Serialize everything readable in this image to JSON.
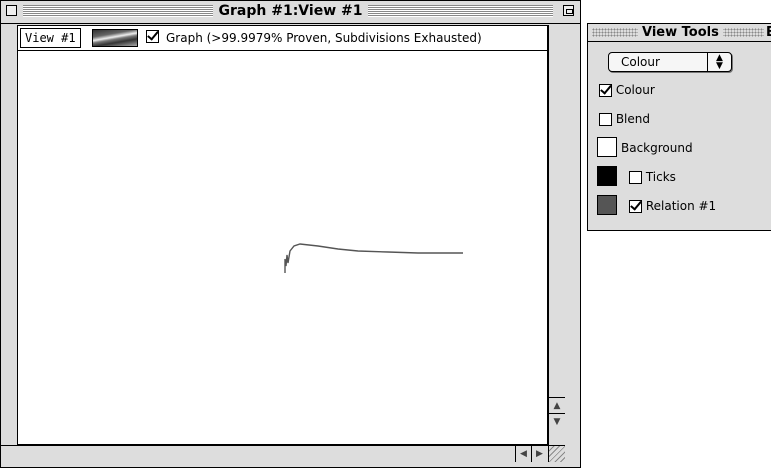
{
  "graph_window": {
    "title": "Graph #1:View #1",
    "view_button_label": "View #1",
    "graph_checkbox_checked": true,
    "graph_status_label": "Graph (>99.9979% Proven, Subdivisions Exhausted)"
  },
  "view_tools": {
    "title": "View Tools",
    "title_overflow": "E",
    "mode_popup_value": "Colour",
    "colour": {
      "label": "Colour",
      "checked": true
    },
    "blend": {
      "label": "Blend",
      "checked": false
    },
    "background": {
      "label": "Background",
      "color": "#ffffff"
    },
    "ticks": {
      "label": "Ticks",
      "checked": false,
      "color": "#000000"
    },
    "relation": {
      "label": "Relation #1",
      "checked": true,
      "color": "#555555"
    }
  },
  "icons": {
    "close": "close-box",
    "zoom": "zoom-box",
    "scroll_up": "arrow-up",
    "scroll_down": "arrow-down",
    "scroll_left": "arrow-left",
    "scroll_right": "arrow-right",
    "resize": "grow-box"
  }
}
